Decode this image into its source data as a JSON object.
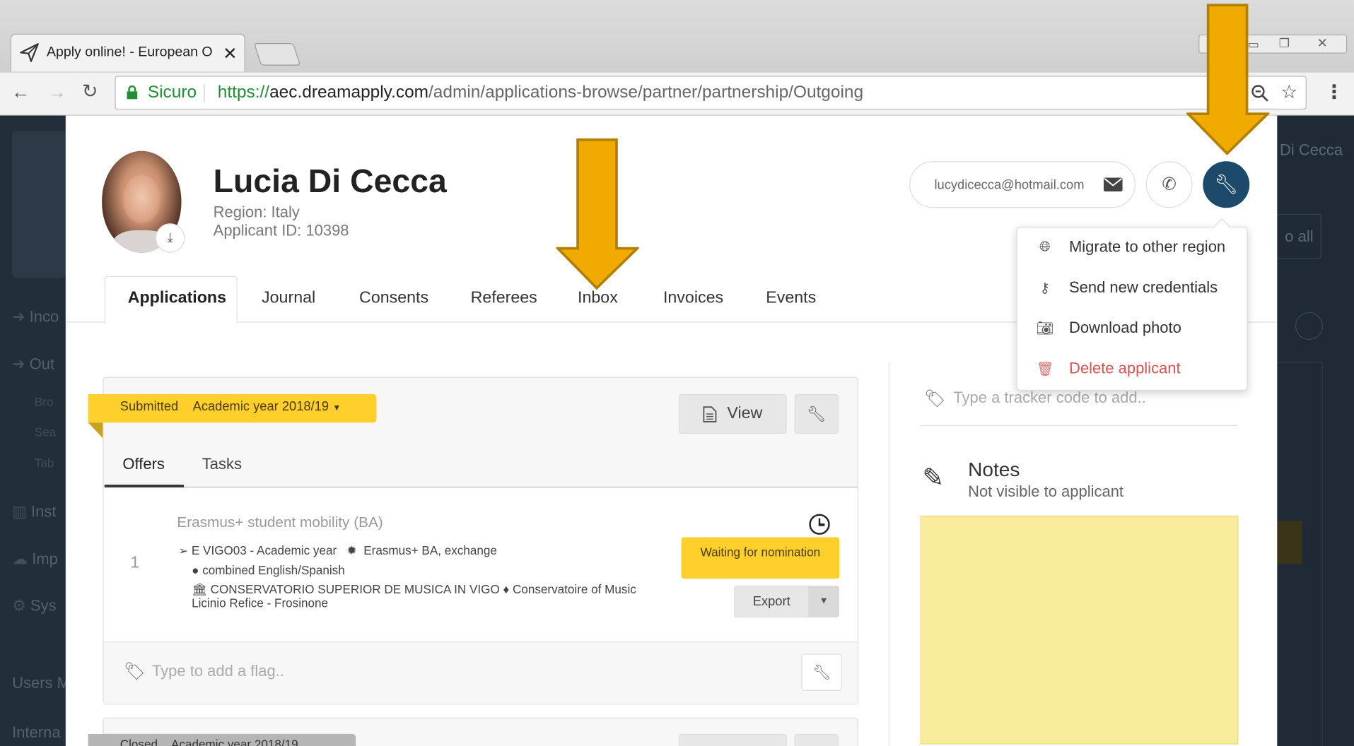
{
  "browser": {
    "tab_title": "Apply online! - European O",
    "security_label": "Sicuro",
    "url_scheme": "https://",
    "url_host": "aec.dreamapply.com",
    "url_path": "/admin/applications-browse/partner/partnership/Outgoing"
  },
  "background": {
    "sidebar_items": [
      "Inco",
      "Out",
      "Bro",
      "Sea",
      "Tab",
      "Inst",
      "Imp",
      "Sys",
      "Users M",
      "Interna"
    ],
    "right_name": "Di Cecca",
    "right_button": "o all"
  },
  "applicant": {
    "name": "Lucia Di Cecca",
    "region": "Region: Italy",
    "applicant_id": "Applicant ID: 10398",
    "email": "lucydicecca@hotmail.com"
  },
  "tabs": [
    "Applications",
    "Journal",
    "Consents",
    "Referees",
    "Inbox",
    "Invoices",
    "Events"
  ],
  "menu": {
    "items": [
      {
        "label": "Migrate to other region",
        "icon": "globe-icon"
      },
      {
        "label": "Send new credentials",
        "icon": "key-icon"
      },
      {
        "label": "Download photo",
        "icon": "camera-icon"
      },
      {
        "label": "Delete applicant",
        "icon": "trash-icon"
      }
    ]
  },
  "application": {
    "status": "Submitted",
    "year": "Academic year 2018/19",
    "view_label": "View",
    "subtabs": [
      "Offers",
      "Tasks"
    ],
    "offer": {
      "number": "1",
      "title": "Erasmus+ student mobility (BA)",
      "partner": "E VIGO03 - Academic year",
      "programme": "Erasmus+ BA, exchange",
      "language": "combined English/Spanish",
      "institution_line1": "CONSERVATORIO SUPERIOR DE MUSICA IN VIGO ♦ Conservatoire of Music",
      "institution_line2": "Licinio Refice - Frosinone",
      "status": "Waiting for nomination",
      "export_label": "Export"
    },
    "flag_placeholder": "Type to add a flag.."
  },
  "application2": {
    "status": "Closed",
    "year": "Academic year 2018/19"
  },
  "sidebar": {
    "tracker_placeholder": "Type a tracker code to add..",
    "notes_title": "Notes",
    "notes_subtitle": "Not visible to applicant"
  },
  "colors": {
    "accent_yellow": "#ffd02b",
    "arrow": "#f0aa00",
    "wrench_button": "#1d4a6a",
    "secure_green": "#1e8f32",
    "danger": "#d9534f",
    "notes_bg": "#f9ec9c"
  }
}
